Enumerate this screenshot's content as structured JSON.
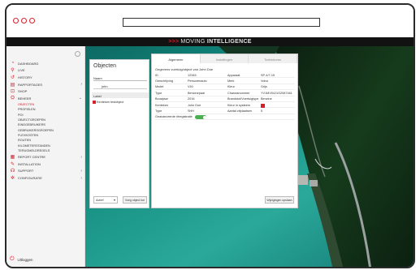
{
  "browser": {
    "url": ""
  },
  "header": {
    "chevrons": ">>>",
    "brand_light": "MOVING",
    "brand_bold": "INTELLIGENCE"
  },
  "sidebar": {
    "items": [
      {
        "icon": "dashboard-icon",
        "label": "Dashboard",
        "arrow": ""
      },
      {
        "icon": "map-pin-icon",
        "label": "Live",
        "arrow": ""
      },
      {
        "icon": "history-icon",
        "label": "History",
        "arrow": ""
      },
      {
        "icon": "reports-icon",
        "label": "Rapportages",
        "arrow": "›"
      },
      {
        "icon": "shop-icon",
        "label": "Shop",
        "arrow": ""
      },
      {
        "icon": "beheer-icon",
        "label": "Beheer",
        "arrow": "⌄"
      }
    ],
    "subitems": [
      "Objecten",
      "Profielen",
      "POI",
      "Objectgroepen",
      "Eindgebruikers",
      "Gebruikersgroepen",
      "Flexkosten",
      "Routen",
      "Kilometerstanden",
      "Terugmeldregels"
    ],
    "items_after": [
      {
        "icon": "report-center-icon",
        "label": "Report centre",
        "arrow": "›"
      },
      {
        "icon": "wrench-icon",
        "label": "Installation",
        "arrow": ""
      },
      {
        "icon": "support-icon",
        "label": "Support",
        "arrow": "›"
      },
      {
        "icon": "settings-icon",
        "label": "Configuratie",
        "arrow": "›"
      }
    ],
    "logout": "Uitloggen"
  },
  "objects_panel": {
    "title": "Objecten",
    "filter": "Naam",
    "search": "john",
    "group": "Label",
    "item": "Kenteken testobject",
    "status_select": "Actief",
    "new_button": "Voeg object toe"
  },
  "detail_panel": {
    "tabs": [
      "Algemeen",
      "Instellingen",
      "Toebehoren"
    ],
    "heading": "Gegevens voertuig/object van John Doe",
    "rows": [
      [
        "ID",
        "12345",
        "Apparaat",
        "SP-4/7-15"
      ],
      [
        "Omschrijving",
        "Personenauto",
        "Merk",
        "Volvo"
      ],
      [
        "Model",
        "V40",
        "Kleur",
        "Grijs"
      ],
      [
        "Type",
        "Benzinepaal",
        "Chassisnummer",
        "YV1MV04J1G2087461"
      ],
      [
        "Bouwjaar",
        "2016",
        "Brandstof/Voertuigtype",
        "Benzine"
      ],
      [
        "Kenteken",
        "John Doe",
        "Kleur in systeem",
        ""
      ],
      [
        "Type",
        "SHH",
        "Aantal zitplaatsen",
        "5"
      ],
      [
        "Geavanceerde ritregistratie",
        "",
        "",
        ""
      ]
    ],
    "save_button": "Wijzigingen opslaan"
  },
  "colors": {
    "accent": "#d8202a",
    "topbar": "#121212",
    "toggle_on": "#48b04e"
  }
}
